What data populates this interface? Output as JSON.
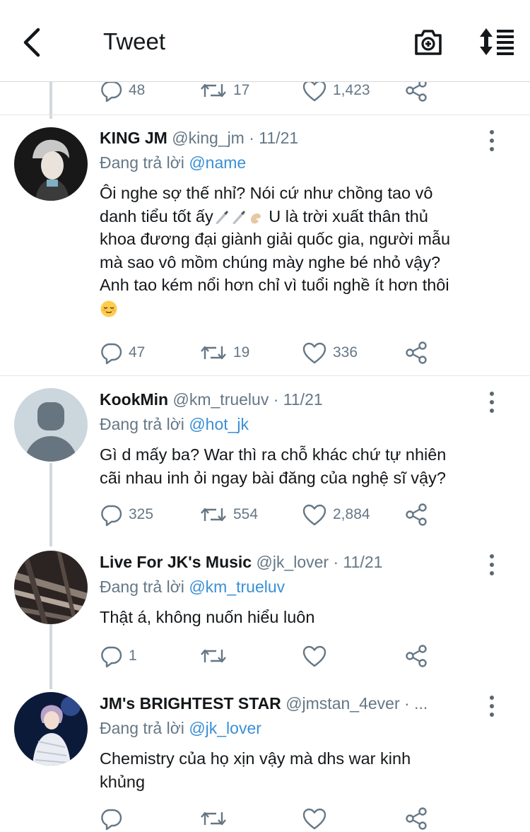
{
  "header": {
    "title": "Tweet",
    "back_icon": "chevron-left-icon",
    "camera_icon": "camera-plus-icon",
    "sort_icon": "sort-icon"
  },
  "top_actions": {
    "reply_count": "48",
    "retweet_count": "17",
    "like_count": "1,423"
  },
  "tweets": [
    {
      "display_name": "KING JM",
      "handle": "@king_jm",
      "dot": "·",
      "date": "11/21",
      "reply_prefix": "Đang trả lời",
      "reply_to": "@name",
      "body_parts": [
        "Ôi nghe sợ thế nhỉ? Nói cứ như chồng tao vô",
        "danh tiểu tốt ấy",
        " U là trời xuất thân thủ",
        "khoa đương đại giành giải quốc gia, người mẫu",
        "mà sao vô mồm chúng mày nghe bé nhỏ vậy?",
        "Anh tao kém nổi hơn chỉ vì tuổi nghề ít hơn thôi"
      ],
      "emoji_names": [
        "knife-icon",
        "knife-icon",
        "pinching-hand-icon",
        "relieved-face-icon"
      ],
      "reply_count": "47",
      "retweet_count": "19",
      "like_count": "336"
    },
    {
      "display_name": "KookMin",
      "handle": "@km_trueluv",
      "dot": "·",
      "date": "11/21",
      "reply_prefix": "Đang trả lời",
      "reply_to": "@hot_jk",
      "body_lines": [
        "Gì d mấy ba? War thì ra chỗ khác chứ tự nhiên",
        "cãi nhau inh ỏi ngay bài đăng của nghệ sĩ vậy?"
      ],
      "reply_count": "325",
      "retweet_count": "554",
      "like_count": "2,884"
    },
    {
      "display_name": "Live For JK's Music",
      "handle": "@jk_lover",
      "dot": "·",
      "date": "11/21",
      "reply_prefix": "Đang trả lời",
      "reply_to": "@km_trueluv",
      "body_lines": [
        "Thật á, không nuốn hiểu luôn"
      ],
      "reply_count": "1",
      "retweet_count": "",
      "like_count": ""
    },
    {
      "display_name": "JM's BRIGHTEST STAR",
      "handle": "@jmstan_4ever",
      "dot": "·",
      "date": "...",
      "reply_prefix": "Đang trả lời",
      "reply_to": "@jk_lover",
      "body_lines": [
        "Chemistry của họ xịn vậy mà dhs war kinh",
        "khủng"
      ],
      "reply_count": "",
      "retweet_count": "",
      "like_count": ""
    }
  ],
  "colors": {
    "mention": "#3a8fd6",
    "secondary_text": "#657786",
    "thread_line": "#d4d8dc",
    "icon": "#657786"
  }
}
